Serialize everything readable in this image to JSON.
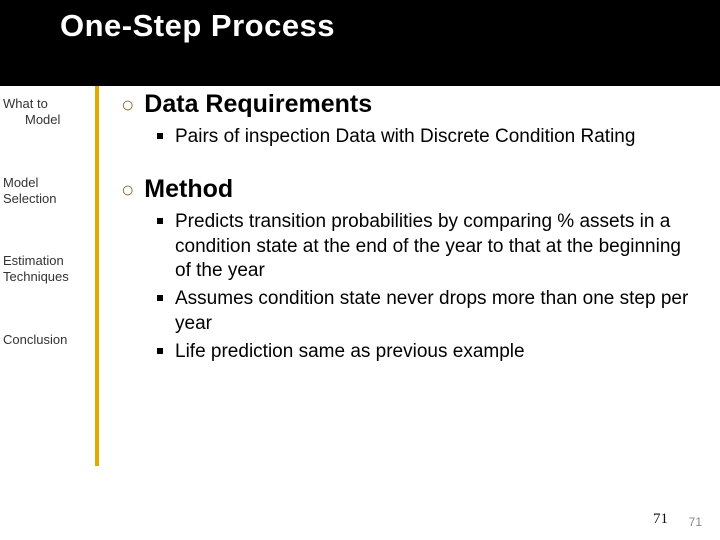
{
  "title": "One-Step Process",
  "sidebar": {
    "items": [
      {
        "line1": "What to",
        "line2": "Model"
      },
      {
        "line1": "Model",
        "line2": "Selection"
      },
      {
        "line1": "Estimation",
        "line2": "Techniques"
      },
      {
        "line1": "Conclusion",
        "line2": ""
      }
    ]
  },
  "content": {
    "sections": [
      {
        "heading": "Data Requirements",
        "bullets": [
          "Pairs of inspection Data with Discrete Condition Rating"
        ]
      },
      {
        "heading": "Method",
        "bullets": [
          "Predicts transition probabilities by comparing % assets in a condition state at the end of the year to that at the beginning of the year",
          "Assumes condition state never drops more than one step per year",
          "Life prediction same as previous example"
        ]
      }
    ]
  },
  "page_numbers": {
    "dark": "71",
    "light": "71"
  }
}
